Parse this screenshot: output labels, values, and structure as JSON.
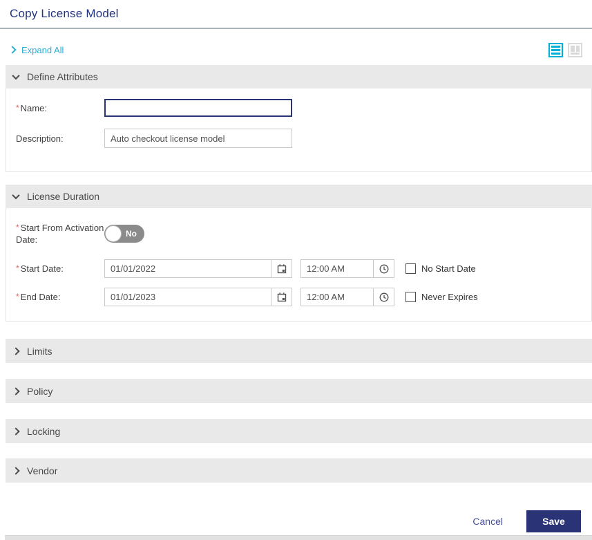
{
  "header": {
    "title": "Copy License Model"
  },
  "toolbar": {
    "expand_all_label": "Expand All"
  },
  "view_toggle": {
    "list_view_icon": "list-view",
    "column_view_icon": "column-view",
    "active_view": "list-view"
  },
  "sections": [
    {
      "label": "Define Attributes",
      "state": "expanded"
    },
    {
      "label": "License Duration",
      "state": "expanded"
    },
    {
      "label": "Limits",
      "state": "collapsed"
    },
    {
      "label": "Policy",
      "state": "collapsed"
    },
    {
      "label": "Locking",
      "state": "collapsed"
    },
    {
      "label": "Vendor",
      "state": "collapsed"
    }
  ],
  "required_marker": "*",
  "define_attributes": {
    "name": {
      "label": "Name:",
      "value": "",
      "required": true
    },
    "description": {
      "label": "Description:",
      "value": "Auto checkout license model",
      "required": false
    }
  },
  "license_duration": {
    "start_from_activation": {
      "label": "Start From Activation Date:",
      "toggle_value": "No",
      "toggle_state": "off",
      "required": true
    },
    "start_date": {
      "label": "Start Date:",
      "date": "01/01/2022",
      "time": "12:00 AM",
      "checkbox_label": "No Start Date",
      "checkbox_checked": false,
      "required": true
    },
    "end_date": {
      "label": "End Date:",
      "date": "01/01/2023",
      "time": "12:00 AM",
      "checkbox_label": "Never Expires",
      "checkbox_checked": false,
      "required": true
    }
  },
  "footer": {
    "cancel_label": "Cancel",
    "save_label": "Save"
  },
  "colors": {
    "accent_cyan": "#29aed3",
    "navy": "#2b3377",
    "title_navy": "#24337f",
    "required_red": "#e25d5d",
    "section_header_bg": "#e9e9e9",
    "toggle_gray": "#8b8b8b"
  }
}
